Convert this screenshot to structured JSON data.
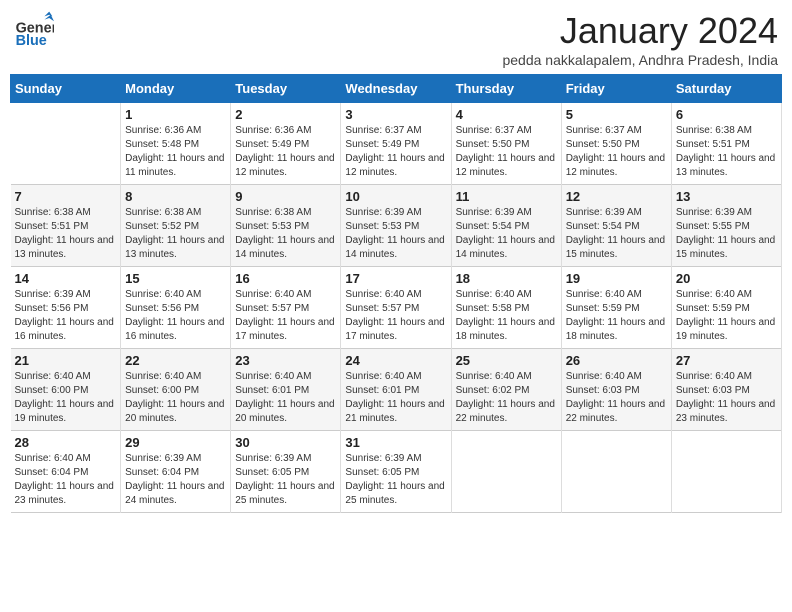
{
  "header": {
    "logo_general": "General",
    "logo_blue": "Blue",
    "month": "January 2024",
    "location": "pedda nakkalapalem, Andhra Pradesh, India"
  },
  "days_of_week": [
    "Sunday",
    "Monday",
    "Tuesday",
    "Wednesday",
    "Thursday",
    "Friday",
    "Saturday"
  ],
  "weeks": [
    [
      {
        "num": "",
        "info": ""
      },
      {
        "num": "1",
        "info": "Sunrise: 6:36 AM\nSunset: 5:48 PM\nDaylight: 11 hours and 11 minutes."
      },
      {
        "num": "2",
        "info": "Sunrise: 6:36 AM\nSunset: 5:49 PM\nDaylight: 11 hours and 12 minutes."
      },
      {
        "num": "3",
        "info": "Sunrise: 6:37 AM\nSunset: 5:49 PM\nDaylight: 11 hours and 12 minutes."
      },
      {
        "num": "4",
        "info": "Sunrise: 6:37 AM\nSunset: 5:50 PM\nDaylight: 11 hours and 12 minutes."
      },
      {
        "num": "5",
        "info": "Sunrise: 6:37 AM\nSunset: 5:50 PM\nDaylight: 11 hours and 12 minutes."
      },
      {
        "num": "6",
        "info": "Sunrise: 6:38 AM\nSunset: 5:51 PM\nDaylight: 11 hours and 13 minutes."
      }
    ],
    [
      {
        "num": "7",
        "info": "Sunrise: 6:38 AM\nSunset: 5:51 PM\nDaylight: 11 hours and 13 minutes."
      },
      {
        "num": "8",
        "info": "Sunrise: 6:38 AM\nSunset: 5:52 PM\nDaylight: 11 hours and 13 minutes."
      },
      {
        "num": "9",
        "info": "Sunrise: 6:38 AM\nSunset: 5:53 PM\nDaylight: 11 hours and 14 minutes."
      },
      {
        "num": "10",
        "info": "Sunrise: 6:39 AM\nSunset: 5:53 PM\nDaylight: 11 hours and 14 minutes."
      },
      {
        "num": "11",
        "info": "Sunrise: 6:39 AM\nSunset: 5:54 PM\nDaylight: 11 hours and 14 minutes."
      },
      {
        "num": "12",
        "info": "Sunrise: 6:39 AM\nSunset: 5:54 PM\nDaylight: 11 hours and 15 minutes."
      },
      {
        "num": "13",
        "info": "Sunrise: 6:39 AM\nSunset: 5:55 PM\nDaylight: 11 hours and 15 minutes."
      }
    ],
    [
      {
        "num": "14",
        "info": "Sunrise: 6:39 AM\nSunset: 5:56 PM\nDaylight: 11 hours and 16 minutes."
      },
      {
        "num": "15",
        "info": "Sunrise: 6:40 AM\nSunset: 5:56 PM\nDaylight: 11 hours and 16 minutes."
      },
      {
        "num": "16",
        "info": "Sunrise: 6:40 AM\nSunset: 5:57 PM\nDaylight: 11 hours and 17 minutes."
      },
      {
        "num": "17",
        "info": "Sunrise: 6:40 AM\nSunset: 5:57 PM\nDaylight: 11 hours and 17 minutes."
      },
      {
        "num": "18",
        "info": "Sunrise: 6:40 AM\nSunset: 5:58 PM\nDaylight: 11 hours and 18 minutes."
      },
      {
        "num": "19",
        "info": "Sunrise: 6:40 AM\nSunset: 5:59 PM\nDaylight: 11 hours and 18 minutes."
      },
      {
        "num": "20",
        "info": "Sunrise: 6:40 AM\nSunset: 5:59 PM\nDaylight: 11 hours and 19 minutes."
      }
    ],
    [
      {
        "num": "21",
        "info": "Sunrise: 6:40 AM\nSunset: 6:00 PM\nDaylight: 11 hours and 19 minutes."
      },
      {
        "num": "22",
        "info": "Sunrise: 6:40 AM\nSunset: 6:00 PM\nDaylight: 11 hours and 20 minutes."
      },
      {
        "num": "23",
        "info": "Sunrise: 6:40 AM\nSunset: 6:01 PM\nDaylight: 11 hours and 20 minutes."
      },
      {
        "num": "24",
        "info": "Sunrise: 6:40 AM\nSunset: 6:01 PM\nDaylight: 11 hours and 21 minutes."
      },
      {
        "num": "25",
        "info": "Sunrise: 6:40 AM\nSunset: 6:02 PM\nDaylight: 11 hours and 22 minutes."
      },
      {
        "num": "26",
        "info": "Sunrise: 6:40 AM\nSunset: 6:03 PM\nDaylight: 11 hours and 22 minutes."
      },
      {
        "num": "27",
        "info": "Sunrise: 6:40 AM\nSunset: 6:03 PM\nDaylight: 11 hours and 23 minutes."
      }
    ],
    [
      {
        "num": "28",
        "info": "Sunrise: 6:40 AM\nSunset: 6:04 PM\nDaylight: 11 hours and 23 minutes."
      },
      {
        "num": "29",
        "info": "Sunrise: 6:39 AM\nSunset: 6:04 PM\nDaylight: 11 hours and 24 minutes."
      },
      {
        "num": "30",
        "info": "Sunrise: 6:39 AM\nSunset: 6:05 PM\nDaylight: 11 hours and 25 minutes."
      },
      {
        "num": "31",
        "info": "Sunrise: 6:39 AM\nSunset: 6:05 PM\nDaylight: 11 hours and 25 minutes."
      },
      {
        "num": "",
        "info": ""
      },
      {
        "num": "",
        "info": ""
      },
      {
        "num": "",
        "info": ""
      }
    ]
  ]
}
